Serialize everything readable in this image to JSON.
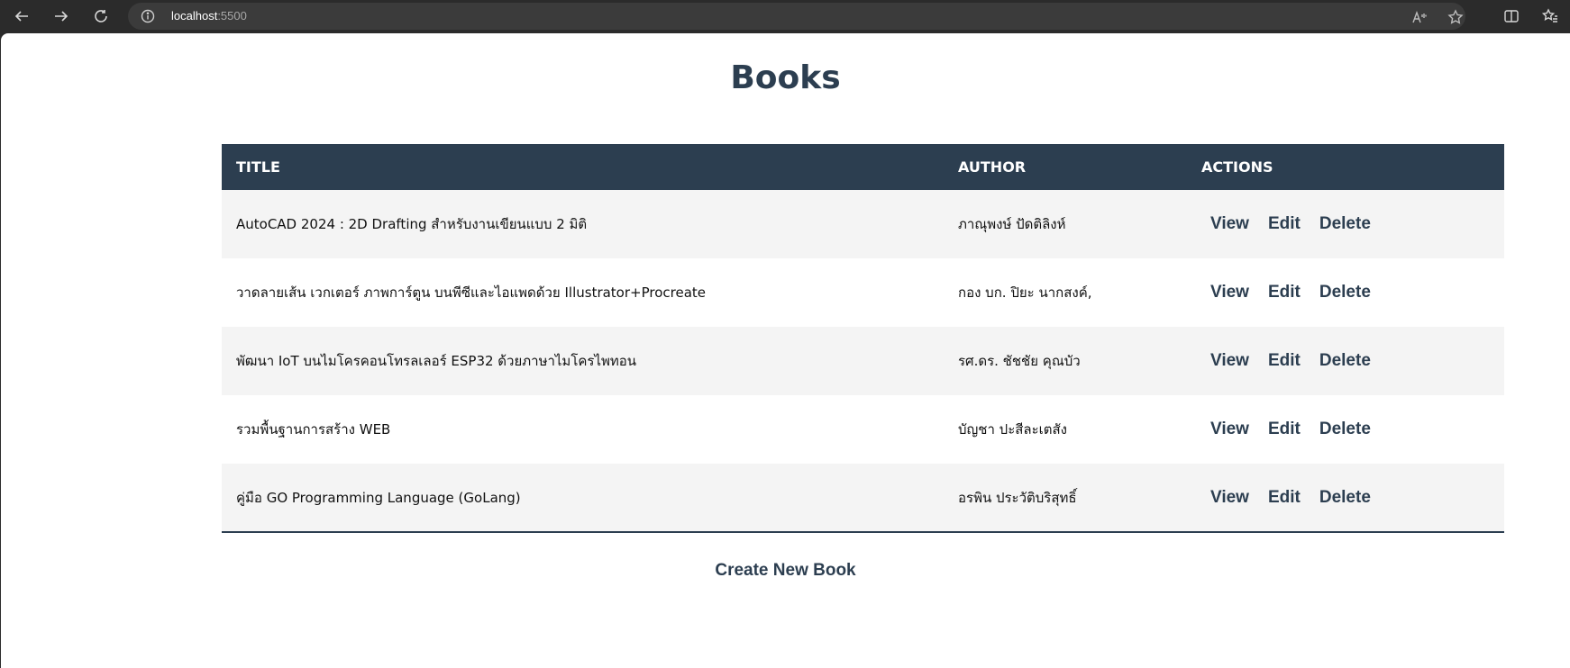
{
  "browser": {
    "url_host": "localhost",
    "url_port": ":5500",
    "icons": [
      "back-icon",
      "forward-icon",
      "refresh-icon",
      "info-icon",
      "read-aloud-icon",
      "favorite-star-icon",
      "split-screen-icon",
      "favorites-icon"
    ]
  },
  "page": {
    "title": "Books",
    "table": {
      "headers": {
        "title": "TITLE",
        "author": "AUTHOR",
        "actions": "ACTIONS"
      },
      "rows": [
        {
          "title": "AutoCAD 2024 : 2D Drafting สำหรับงานเขียนแบบ 2 มิติ",
          "author": "ภาณุพงษ์ ปัดติลิงห์"
        },
        {
          "title": "วาดลายเส้น เวกเตอร์ ภาพการ์ตูน บนพีซีและไอแพดด้วย Illustrator+Procreate",
          "author": "กอง บก. ปิยะ นากสงค์,"
        },
        {
          "title": "พัฒนา IoT บนไมโครคอนโทรลเลอร์ ESP32 ด้วยภาษาไมโครไพทอน",
          "author": "รศ.ดร. ชัชชัย คุณบัว"
        },
        {
          "title": "รวมพื้นฐานการสร้าง WEB",
          "author": "บัญชา ปะสีละเตสัง"
        },
        {
          "title": "คู่มือ GO Programming Language (GoLang)",
          "author": "อรพิน ประวัติบริสุทธิ์"
        }
      ],
      "actions": {
        "view": "View",
        "edit": "Edit",
        "delete": "Delete"
      }
    },
    "create_label": "Create New Book"
  }
}
